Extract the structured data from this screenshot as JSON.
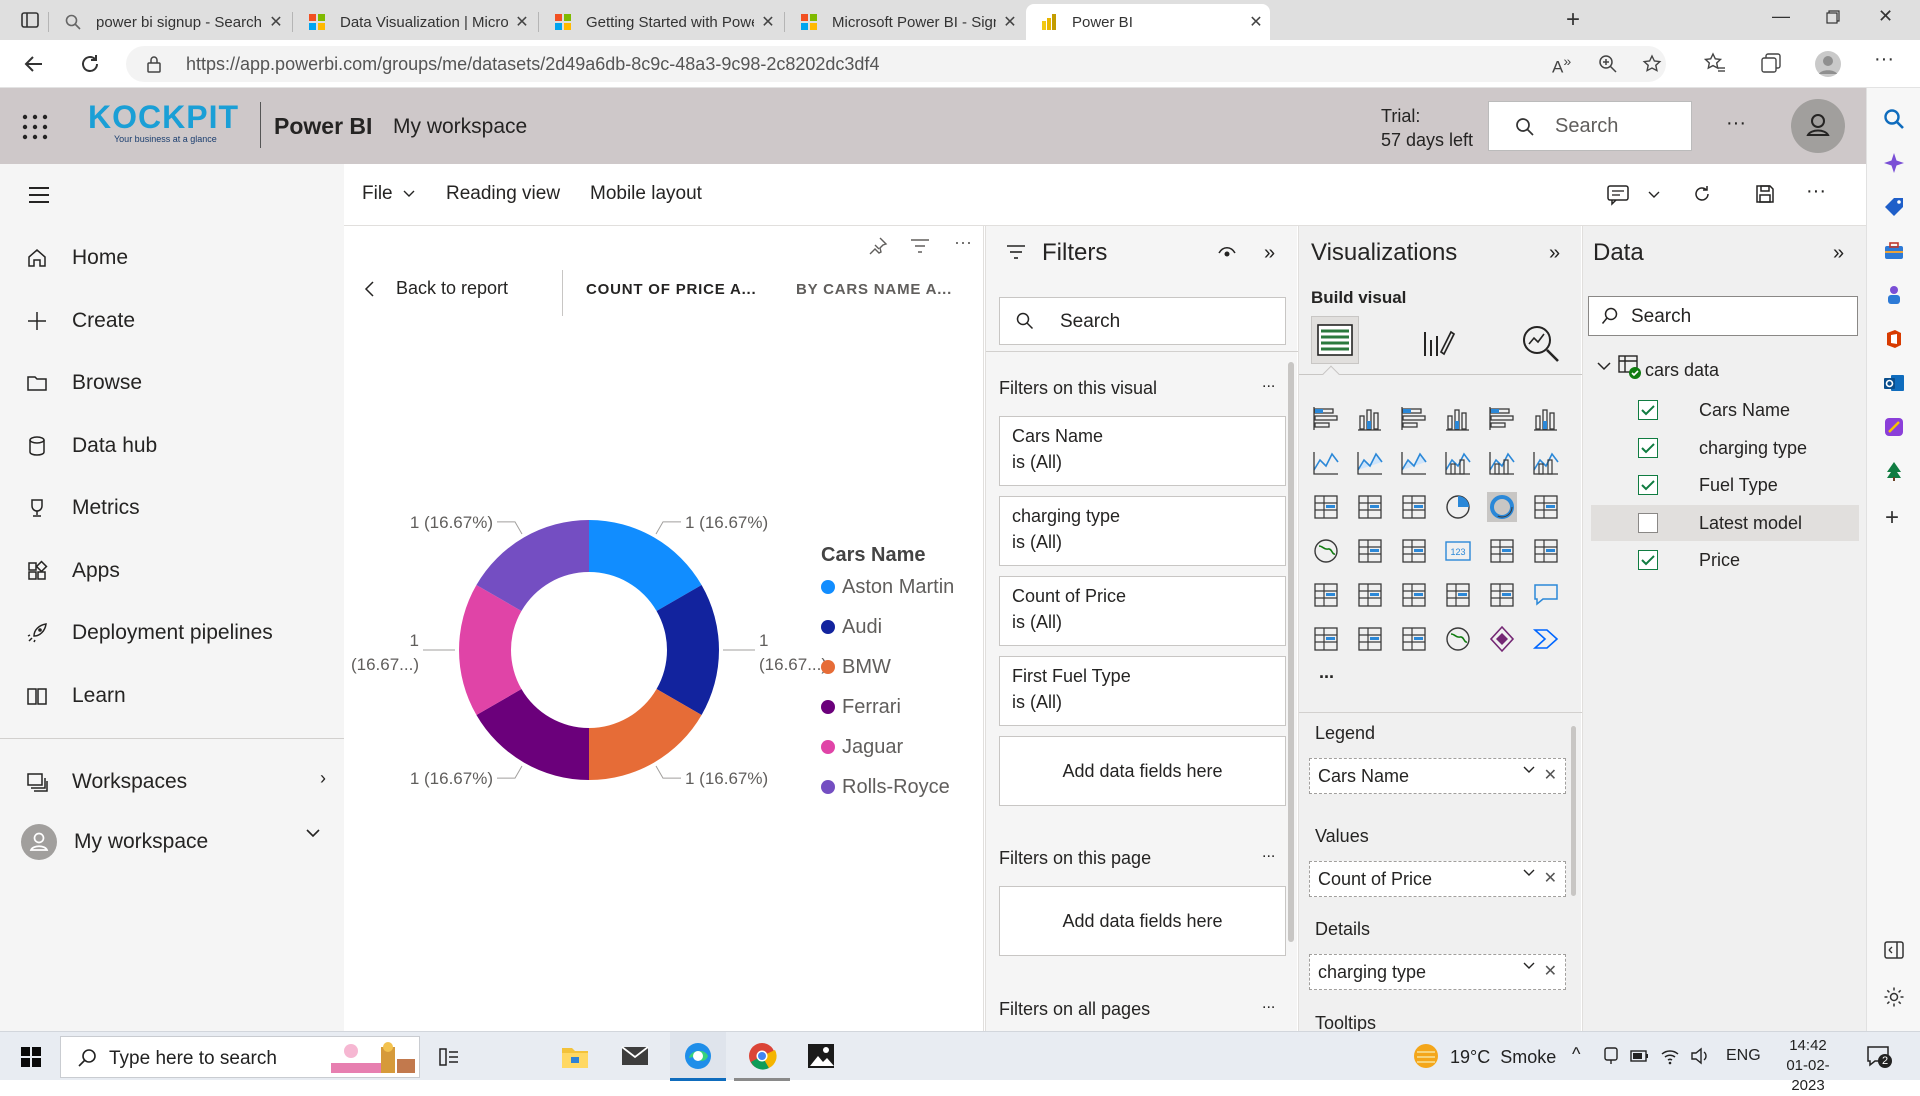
{
  "browser": {
    "tabs": [
      {
        "title": "power bi signup - Search"
      },
      {
        "title": "Data Visualization | Microsoft Po"
      },
      {
        "title": "Getting Started with Power BI for"
      },
      {
        "title": "Microsoft Power BI - Sign up"
      },
      {
        "title": "Power BI"
      }
    ],
    "url": "https://app.powerbi.com/groups/me/datasets/2d49a6db-8c9c-48a3-9c98-2c8202dc3df4"
  },
  "header": {
    "logo_text": "KOCKPIT",
    "logo_tagline": "Your business at a glance",
    "app_name": "Power BI",
    "workspace": "My workspace",
    "trial_line1": "Trial:",
    "trial_line2": "57 days left",
    "search_placeholder": "Search",
    "more": "···"
  },
  "ribbon": {
    "file": "File",
    "reading_view": "Reading view",
    "mobile_layout": "Mobile layout"
  },
  "nav": {
    "items": [
      {
        "label": "Home",
        "icon": "home-icon"
      },
      {
        "label": "Create",
        "icon": "plus-icon"
      },
      {
        "label": "Browse",
        "icon": "folder-icon"
      },
      {
        "label": "Data hub",
        "icon": "database-icon"
      },
      {
        "label": "Metrics",
        "icon": "trophy-icon"
      },
      {
        "label": "Apps",
        "icon": "apps-icon"
      },
      {
        "label": "Deployment pipelines",
        "icon": "rocket-icon"
      },
      {
        "label": "Learn",
        "icon": "book-icon"
      }
    ],
    "workspaces": "Workspaces",
    "my_workspace": "My workspace"
  },
  "canvas": {
    "back": "Back to report",
    "crumb1": "COUNT OF PRICE A...",
    "crumb2": "BY CARS NAME A...",
    "more": "···"
  },
  "chart_data": {
    "type": "pie",
    "donut": true,
    "legend_title": "Cars Name",
    "legend_position": "right",
    "categories": [
      "Aston Martin",
      "Audi",
      "BMW",
      "Ferrari",
      "Jaguar",
      "Rolls-Royce"
    ],
    "values": [
      1,
      1,
      1,
      1,
      1,
      1
    ],
    "colors": [
      "#118dff",
      "#12239e",
      "#e66c37",
      "#6b007b",
      "#e044a7",
      "#744ec2"
    ],
    "data_labels": [
      "1 (16.67%)",
      "1 (16.67...)",
      "1 (16.67%)",
      "1 (16.67%)",
      "1 (16.67...)",
      "1 (16.67%)"
    ]
  },
  "filters": {
    "title": "Filters",
    "search_placeholder": "Search",
    "on_visual": "Filters on this visual",
    "cards": [
      {
        "name": "Cars Name",
        "value": "is (All)"
      },
      {
        "name": "charging type",
        "value": "is (All)"
      },
      {
        "name": "Count of Price",
        "value": "is (All)"
      },
      {
        "name": "First Fuel Type",
        "value": "is (All)"
      }
    ],
    "add_fields": "Add data fields here",
    "on_page": "Filters on this page",
    "add_fields_page": "Add data fields here",
    "on_all": "Filters on all pages",
    "more": "..."
  },
  "visualizations": {
    "title": "Visualizations",
    "build_visual": "Build visual",
    "more": "...",
    "legend_label": "Legend",
    "legend_field": "Cars Name",
    "values_label": "Values",
    "values_field": "Count of Price",
    "details_label": "Details",
    "details_field": "charging type",
    "tooltips_label": "Tooltips"
  },
  "data": {
    "title": "Data",
    "search_placeholder": "Search",
    "table": "cars data",
    "fields": [
      {
        "name": "Cars Name",
        "checked": true
      },
      {
        "name": "charging type",
        "checked": true
      },
      {
        "name": "Fuel Type",
        "checked": true
      },
      {
        "name": "Latest model",
        "checked": false
      },
      {
        "name": "Price",
        "checked": true
      }
    ]
  },
  "taskbar": {
    "search_placeholder": "Type here to search",
    "weather": "19°C  Smoke",
    "lang": "ENG",
    "time": "14:42",
    "date": "01-02-2023",
    "notif_count": "2"
  }
}
